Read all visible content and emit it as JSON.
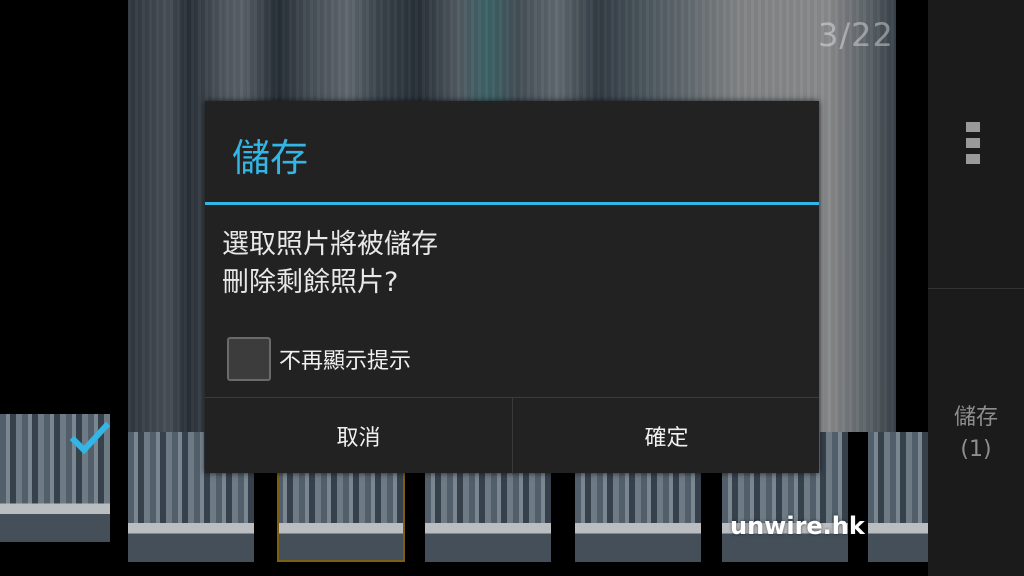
{
  "viewer": {
    "page_counter": "3/22"
  },
  "side_panel": {
    "menu_icon": "overflow-menu-icon",
    "save_label": "儲存",
    "save_count": "(1)"
  },
  "dialog": {
    "title": "儲存",
    "message_line1": "選取照片將被儲存",
    "message_line2": "刪除剩餘照片?",
    "checkbox_label": "不再顯示提示",
    "checkbox_checked": false,
    "cancel_label": "取消",
    "confirm_label": "確定",
    "accent_color": "#33b5e5"
  },
  "watermark": "unwire.hk"
}
